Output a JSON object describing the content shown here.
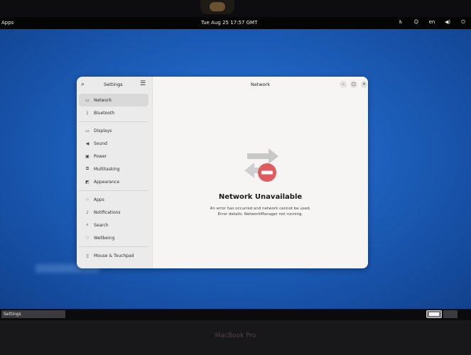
{
  "topbar": {
    "apps_label": "Apps",
    "clock": "Tue Aug 25  17:57 GMT",
    "indicators": {
      "accessibility": "♿",
      "person": "☺",
      "language": "en",
      "volume": "◀)",
      "power": "⏻"
    }
  },
  "settings": {
    "sidebar_title": "Settings",
    "search_icon": "search-icon",
    "menu_icon": "hamburger-menu-icon",
    "nav_groups": [
      [
        {
          "label": "Network",
          "icon": "network-icon",
          "glyph": "▭",
          "selected": true
        },
        {
          "label": "Bluetooth",
          "icon": "bluetooth-icon",
          "glyph": "ᛒ",
          "selected": false
        }
      ],
      [
        {
          "label": "Displays",
          "icon": "display-icon",
          "glyph": "▭",
          "selected": false
        },
        {
          "label": "Sound",
          "icon": "speaker-icon",
          "glyph": "◀",
          "selected": false
        },
        {
          "label": "Power",
          "icon": "battery-icon",
          "glyph": "▣",
          "selected": false
        },
        {
          "label": "Multitasking",
          "icon": "multitasking-icon",
          "glyph": "⧉",
          "selected": false
        },
        {
          "label": "Appearance",
          "icon": "appearance-icon",
          "glyph": "◩",
          "selected": false
        }
      ],
      [
        {
          "label": "Apps",
          "icon": "apps-grid-icon",
          "glyph": "⁘",
          "selected": false
        },
        {
          "label": "Notifications",
          "icon": "bell-icon",
          "glyph": "♪",
          "selected": false
        },
        {
          "label": "Search",
          "icon": "search-icon",
          "glyph": "⌕",
          "selected": false
        },
        {
          "label": "Wellbeing",
          "icon": "wellbeing-icon",
          "glyph": "♡",
          "selected": false
        }
      ],
      [
        {
          "label": "Mouse & Touchpad",
          "icon": "mouse-icon",
          "glyph": "▯",
          "selected": false
        }
      ]
    ],
    "content_title": "Network",
    "window_buttons": {
      "minimize": "–",
      "maximize": "□",
      "close": "×"
    },
    "status": {
      "heading": "Network Unavailable",
      "line1": "An error has occurred and network cannot be used.",
      "line2": "Error details: NetworkManager not running."
    }
  },
  "taskbar": {
    "items": [
      "Settings"
    ]
  },
  "bezel": {
    "brand": "MacBook Pro"
  },
  "colors": {
    "desktop": "#1d5fbb",
    "error_red": "#e05a5f",
    "arrow_gray": "#c8c8c8"
  }
}
